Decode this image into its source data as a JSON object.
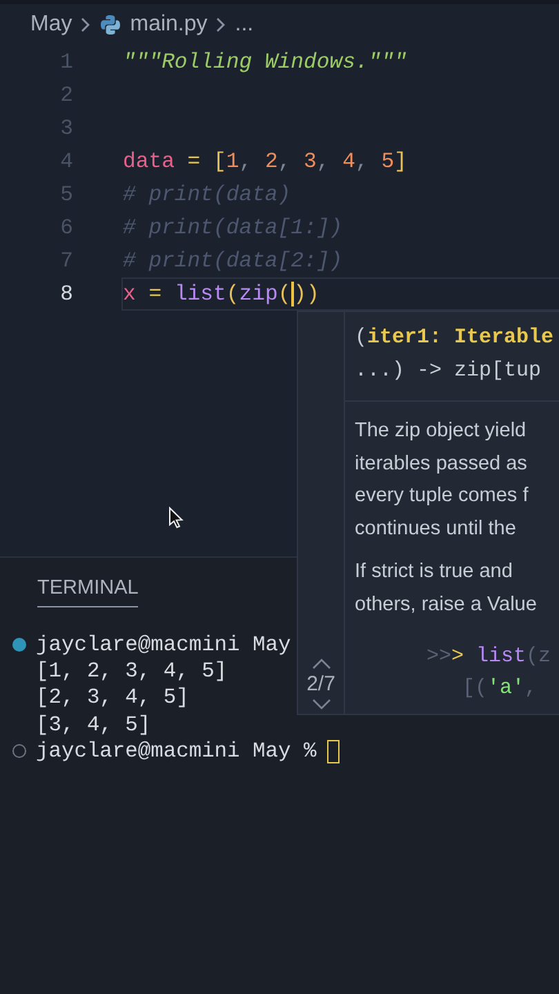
{
  "breadcrumb": {
    "folder": "May",
    "file": "main.py",
    "more": "..."
  },
  "editor": {
    "lines": [
      {
        "number": "1",
        "current": false,
        "tokens": [
          {
            "kind": "string",
            "text": "\"\"\"Rolling Windows.\"\"\""
          }
        ]
      },
      {
        "number": "2",
        "current": false
      },
      {
        "number": "3",
        "current": false
      },
      {
        "number": "4",
        "current": false,
        "tokens": [
          {
            "kind": "variable",
            "text": "data"
          },
          {
            "kind": "operator",
            "text": " = "
          },
          {
            "kind": "bracket",
            "text": "["
          },
          {
            "kind": "number",
            "text": "1"
          },
          {
            "kind": "plain",
            "text": ", "
          },
          {
            "kind": "number",
            "text": "2"
          },
          {
            "kind": "plain",
            "text": ", "
          },
          {
            "kind": "number",
            "text": "3"
          },
          {
            "kind": "plain",
            "text": ", "
          },
          {
            "kind": "number",
            "text": "4"
          },
          {
            "kind": "plain",
            "text": ", "
          },
          {
            "kind": "number",
            "text": "5"
          },
          {
            "kind": "bracket",
            "text": "]"
          }
        ]
      },
      {
        "number": "5",
        "current": false,
        "tokens": [
          {
            "kind": "comment",
            "text": "# print(data)"
          }
        ]
      },
      {
        "number": "6",
        "current": false,
        "tokens": [
          {
            "kind": "comment",
            "text": "# print(data[1:])"
          }
        ]
      },
      {
        "number": "7",
        "current": false,
        "tokens": [
          {
            "kind": "comment",
            "text": "# print(data[2:])"
          }
        ]
      },
      {
        "number": "8",
        "current": true,
        "tokens": [
          {
            "kind": "variable",
            "text": "x"
          },
          {
            "kind": "operator",
            "text": " = "
          },
          {
            "kind": "function",
            "text": "list"
          },
          {
            "kind": "bracket",
            "text": "("
          },
          {
            "kind": "function",
            "text": "zip"
          },
          {
            "kind": "bracket",
            "text": "("
          },
          {
            "kind": "cursor"
          },
          {
            "kind": "bracket",
            "text": ")"
          },
          {
            "kind": "bracket",
            "text": ")"
          }
        ]
      }
    ]
  },
  "terminal": {
    "tab": "TERMINAL",
    "lines": [
      {
        "kind": "command",
        "text": "jayclare@macmini May"
      },
      {
        "kind": "output",
        "text": "[1, 2, 3, 4, 5]"
      },
      {
        "kind": "output",
        "text": "[2, 3, 4, 5]"
      },
      {
        "kind": "output",
        "text": "[3, 4, 5]"
      },
      {
        "kind": "prompt",
        "text": "jayclare@macmini May %"
      }
    ]
  },
  "hover": {
    "signature": [
      [
        {
          "kind": "plain",
          "text": "("
        },
        {
          "kind": "param",
          "text": "iter1: Iterable"
        }
      ],
      [
        {
          "kind": "plain",
          "text": "...) -> zip[tup"
        }
      ]
    ],
    "paragraphs": [
      [
        "The zip object yield",
        "iterables passed as",
        "every tuple comes f",
        "continues until the"
      ],
      [
        "If strict is true and",
        "others, raise a Value"
      ]
    ],
    "example": [
      [
        {
          "kind": "prompt-dim",
          "text": ">>"
        },
        {
          "kind": "prompt",
          "text": "> "
        },
        {
          "kind": "function",
          "text": "list"
        },
        {
          "kind": "paren",
          "text": "(z"
        }
      ],
      [
        {
          "kind": "paren",
          "text": "[("
        },
        {
          "kind": "string",
          "text": "'a'"
        },
        {
          "kind": "paren",
          "text": ","
        }
      ]
    ],
    "overload": "2/7"
  }
}
